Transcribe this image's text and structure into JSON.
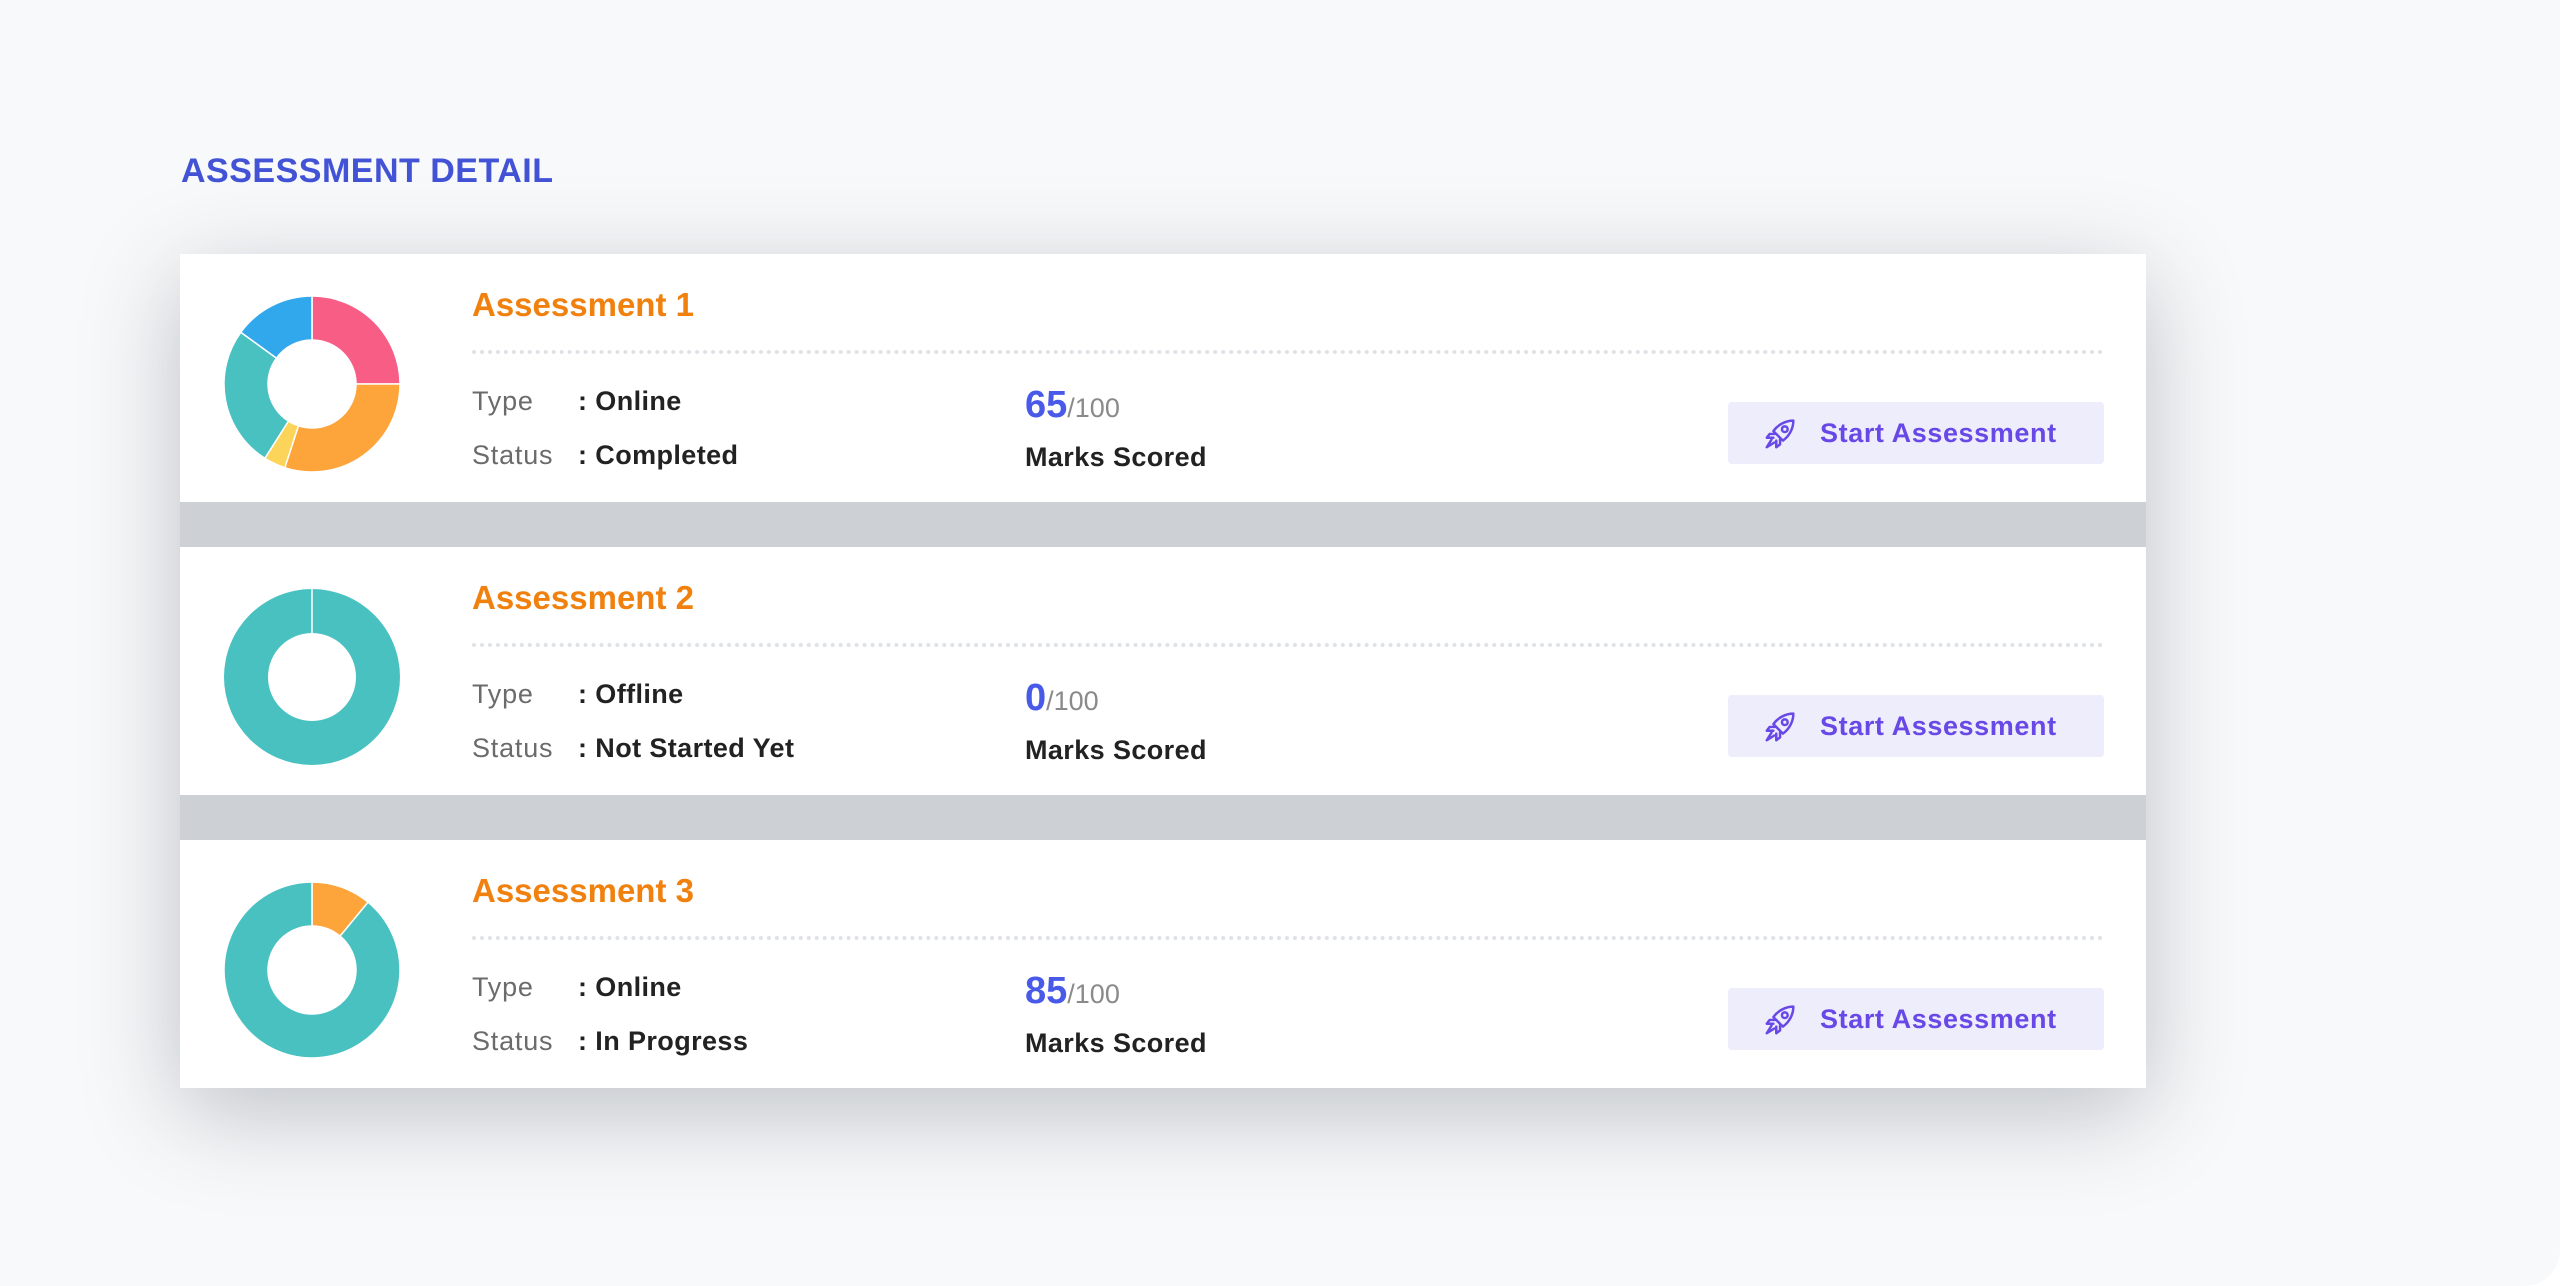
{
  "page": {
    "section_title": "ASSESSMENT DETAIL"
  },
  "colors": {
    "title_blue": "#4353d6",
    "card_title_orange": "#f0810f",
    "score_blue": "#4a5ae8",
    "button_bg": "#eeedfb",
    "button_text": "#6848e6"
  },
  "assessments": [
    {
      "title": "Assessment 1",
      "type_label": "Type",
      "type_value": ": Online",
      "status_label": "Status",
      "status_value": ": Completed",
      "score": "65",
      "score_total": "/100",
      "score_label": "Marks Scored",
      "button_label": "Start Assessment",
      "button_icon": "rocket-icon",
      "chart_segments": [
        {
          "value": 25,
          "color": "#f85d86"
        },
        {
          "value": 30,
          "color": "#fda43a"
        },
        {
          "value": 4,
          "color": "#fdd45a"
        },
        {
          "value": 26,
          "color": "#4ac1c1"
        },
        {
          "value": 15,
          "color": "#32a8ec"
        }
      ]
    },
    {
      "title": "Assessment 2",
      "type_label": "Type",
      "type_value": ": Offline",
      "status_label": "Status",
      "status_value": ": Not Started Yet",
      "score": "0",
      "score_total": "/100",
      "score_label": "Marks Scored",
      "button_label": "Start Assessment",
      "button_icon": "rocket-icon",
      "chart_segments": [
        {
          "value": 100,
          "color": "#4ac1c1"
        }
      ]
    },
    {
      "title": "Assessment 3",
      "type_label": "Type",
      "type_value": ": Online",
      "status_label": "Status",
      "status_value": ": In Progress",
      "score": "85",
      "score_total": "/100",
      "score_label": "Marks Scored",
      "button_label": "Start Assessment",
      "button_icon": "rocket-icon",
      "chart_segments": [
        {
          "value": 11,
          "color": "#fda43a"
        },
        {
          "value": 89,
          "color": "#4ac1c1"
        }
      ]
    }
  ]
}
